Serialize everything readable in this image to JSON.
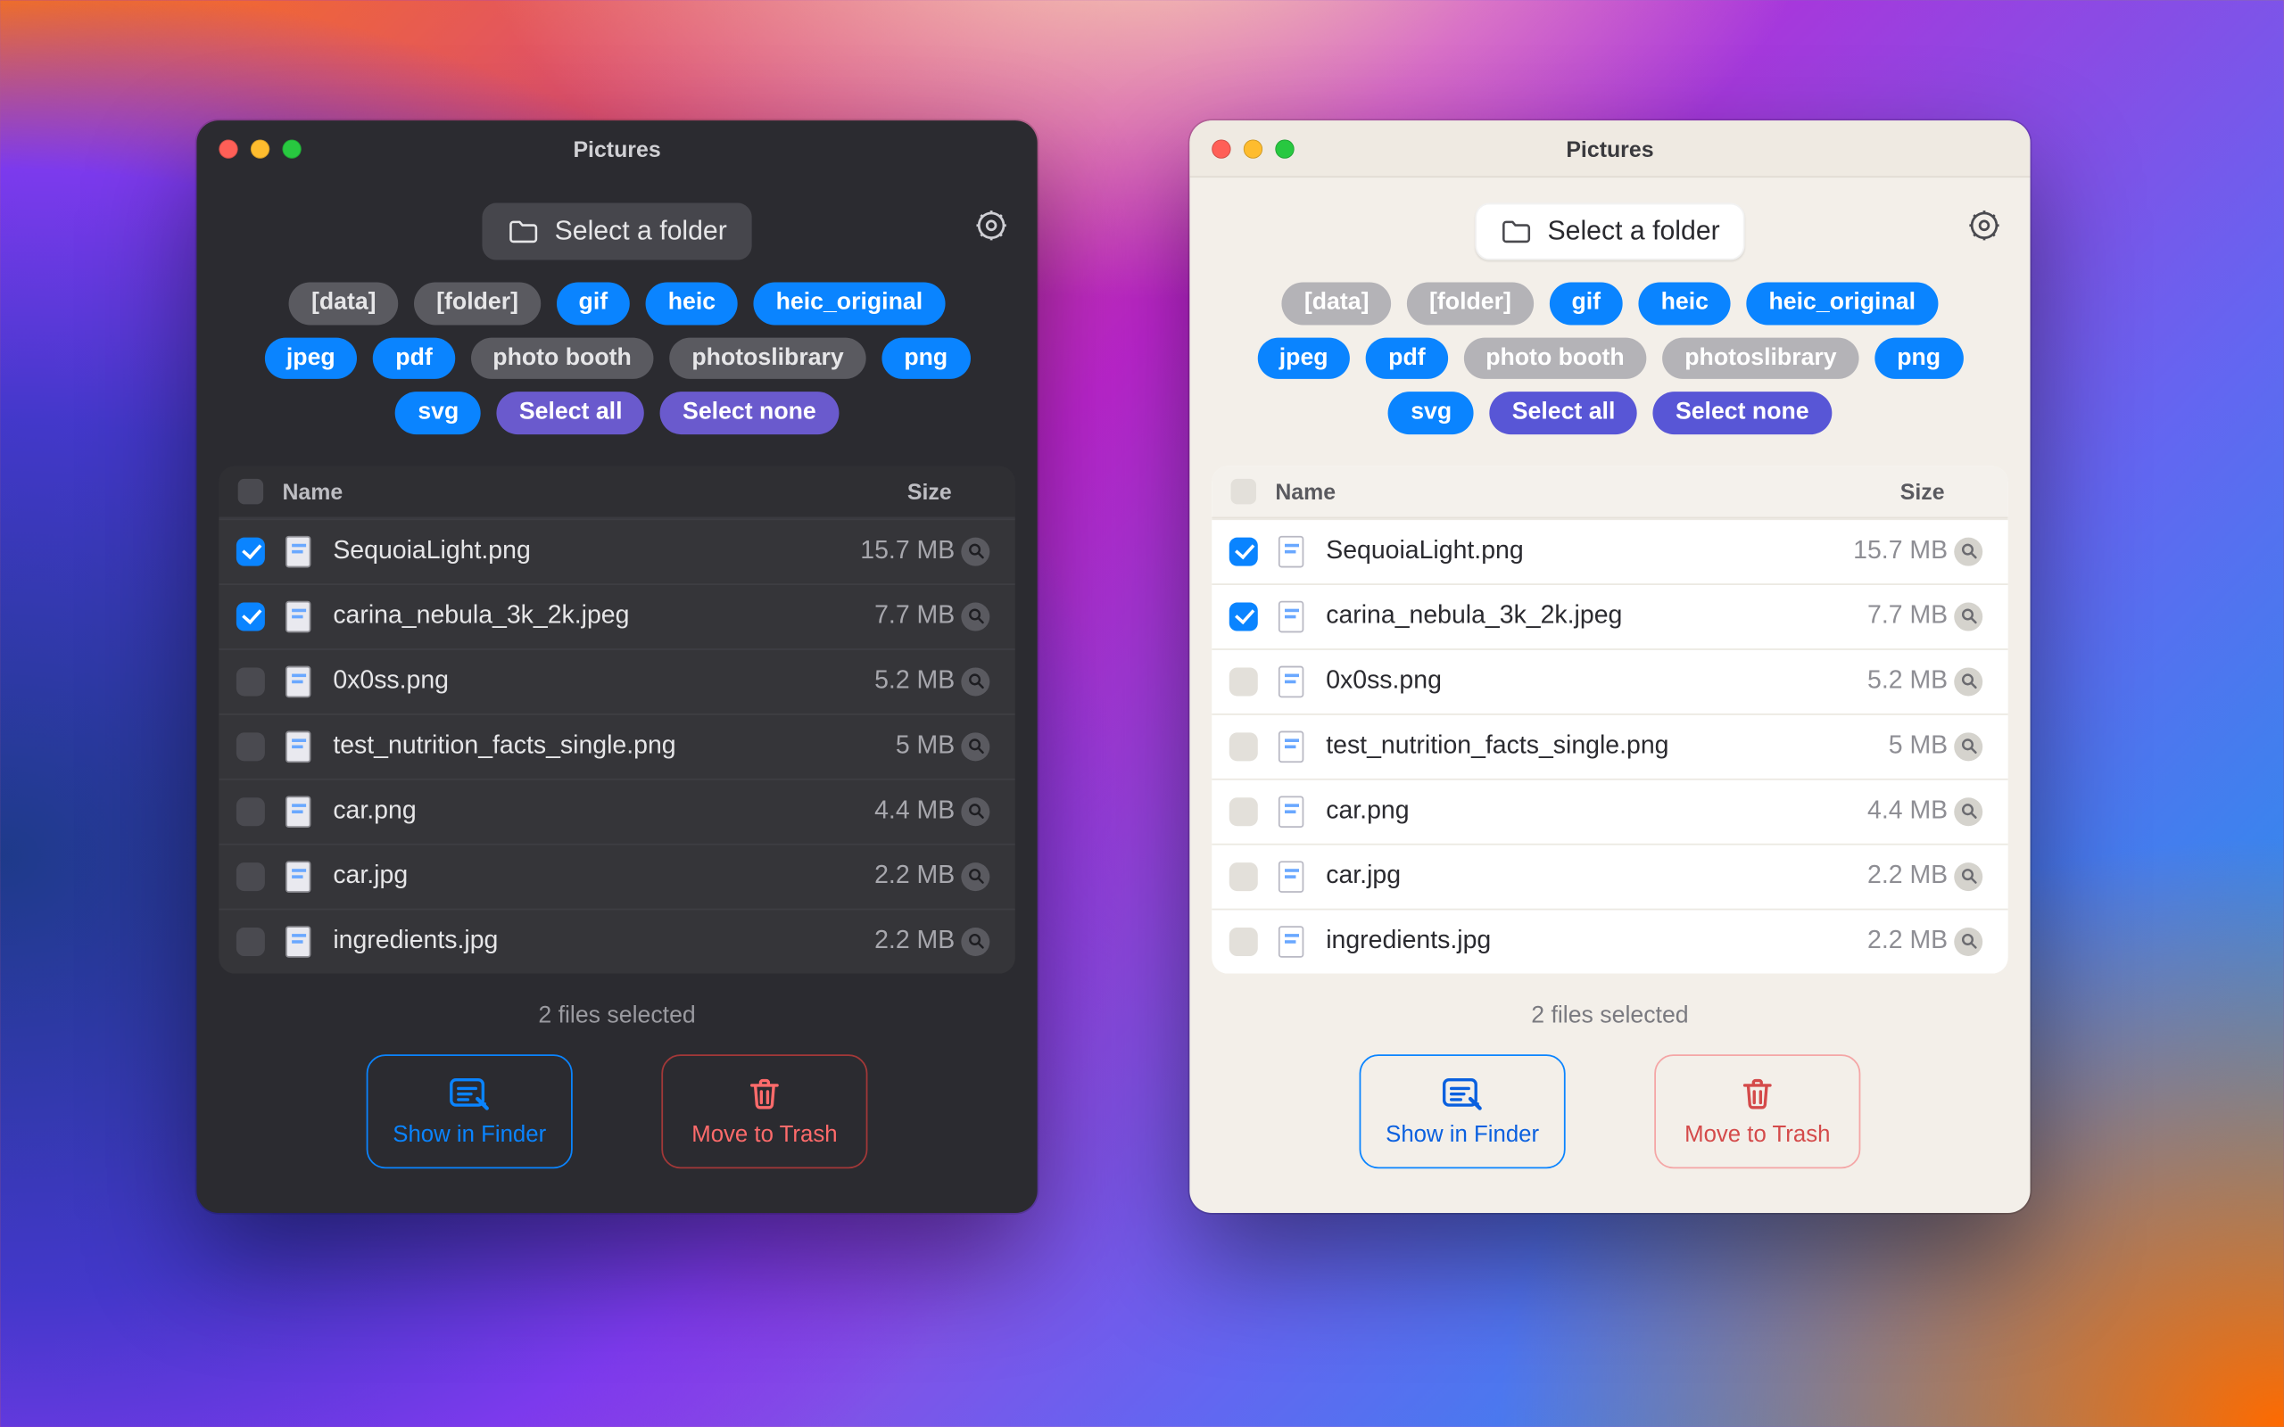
{
  "window_title": "Pictures",
  "folder_button_label": "Select a folder",
  "tags": [
    {
      "label": "[data]",
      "active": false
    },
    {
      "label": "[folder]",
      "active": false
    },
    {
      "label": "gif",
      "active": true
    },
    {
      "label": "heic",
      "active": true
    },
    {
      "label": "heic_original",
      "active": true
    },
    {
      "label": "jpeg",
      "active": true
    },
    {
      "label": "pdf",
      "active": true
    },
    {
      "label": "photo booth",
      "active": false
    },
    {
      "label": "photoslibrary",
      "active": false
    },
    {
      "label": "png",
      "active": true
    },
    {
      "label": "svg",
      "active": true
    }
  ],
  "select_all_label": "Select all",
  "select_none_label": "Select none",
  "columns": {
    "name": "Name",
    "size": "Size"
  },
  "files": [
    {
      "name": "SequoiaLight.png",
      "size": "15.7 MB",
      "checked": true
    },
    {
      "name": "carina_nebula_3k_2k.jpeg",
      "size": "7.7 MB",
      "checked": true
    },
    {
      "name": "0x0ss.png",
      "size": "5.2 MB",
      "checked": false
    },
    {
      "name": "test_nutrition_facts_single.png",
      "size": "5 MB",
      "checked": false
    },
    {
      "name": "car.png",
      "size": "4.4 MB",
      "checked": false
    },
    {
      "name": "car.jpg",
      "size": "2.2 MB",
      "checked": false
    },
    {
      "name": "ingredients.jpg",
      "size": "2.2 MB",
      "checked": false
    }
  ],
  "status_text": "2 files selected",
  "action_show_in_finder": "Show in Finder",
  "action_move_to_trash": "Move to Trash"
}
